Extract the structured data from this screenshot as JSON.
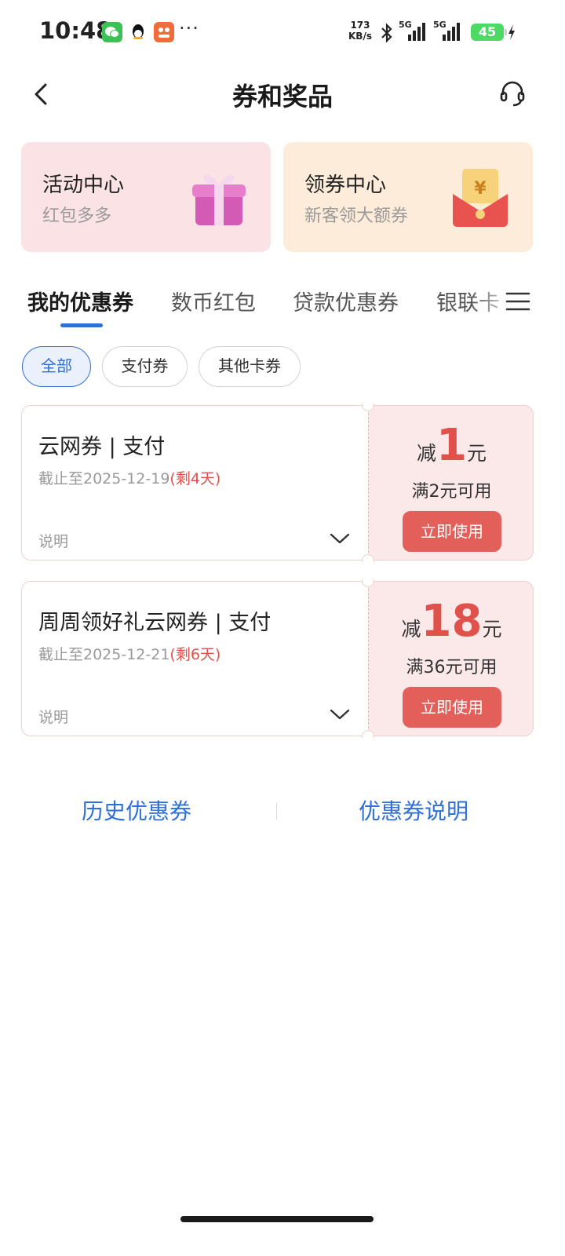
{
  "status_bar": {
    "time": "10:48",
    "net_speed_value": "173",
    "net_speed_unit": "KB/s",
    "signal_1_label": "5G",
    "signal_2_label": "5G",
    "battery": "45",
    "more": "···"
  },
  "header": {
    "title": "券和奖品"
  },
  "entries": {
    "activity": {
      "title": "活动中心",
      "subtitle": "红包多多"
    },
    "coupon_center": {
      "title": "领券中心",
      "subtitle": "新客领大额券"
    }
  },
  "tabs": [
    "我的优惠券",
    "数币红包",
    "贷款优惠券",
    "银联卡"
  ],
  "filters": [
    "全部",
    "支付券",
    "其他卡券"
  ],
  "coupons": [
    {
      "title": "云网券 | 支付",
      "expiry": "截止至2025-12-19",
      "remaining": "(剩4天)",
      "desc_label": "说明",
      "prefix": "减",
      "amount": "1",
      "unit": "元",
      "condition": "满2元可用",
      "button": "立即使用"
    },
    {
      "title": "周周领好礼云网券 | 支付",
      "expiry": "截止至2025-12-21",
      "remaining": "(剩6天)",
      "desc_label": "说明",
      "prefix": "减",
      "amount": "18",
      "unit": "元",
      "condition": "满36元可用",
      "button": "立即使用"
    }
  ],
  "footer": {
    "history": "历史优惠券",
    "rules": "优惠券说明"
  },
  "colors": {
    "accent_blue": "#2f6fd6",
    "coupon_red": "#e0514c",
    "button_red": "#e3605a"
  }
}
